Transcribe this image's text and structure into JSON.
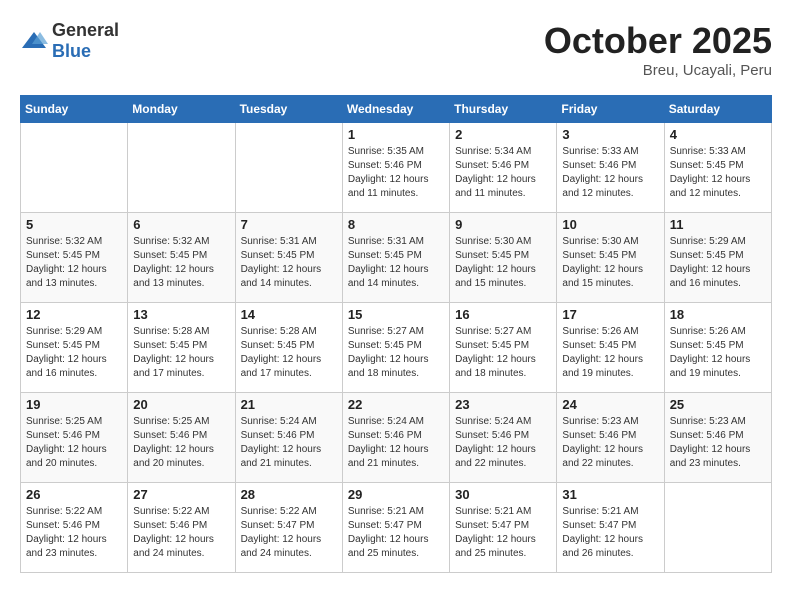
{
  "header": {
    "logo_general": "General",
    "logo_blue": "Blue",
    "title": "October 2025",
    "subtitle": "Breu, Ucayali, Peru"
  },
  "days_of_week": [
    "Sunday",
    "Monday",
    "Tuesday",
    "Wednesday",
    "Thursday",
    "Friday",
    "Saturday"
  ],
  "weeks": [
    [
      {
        "day": "",
        "info": ""
      },
      {
        "day": "",
        "info": ""
      },
      {
        "day": "",
        "info": ""
      },
      {
        "day": "1",
        "info": "Sunrise: 5:35 AM\nSunset: 5:46 PM\nDaylight: 12 hours and 11 minutes."
      },
      {
        "day": "2",
        "info": "Sunrise: 5:34 AM\nSunset: 5:46 PM\nDaylight: 12 hours and 11 minutes."
      },
      {
        "day": "3",
        "info": "Sunrise: 5:33 AM\nSunset: 5:46 PM\nDaylight: 12 hours and 12 minutes."
      },
      {
        "day": "4",
        "info": "Sunrise: 5:33 AM\nSunset: 5:45 PM\nDaylight: 12 hours and 12 minutes."
      }
    ],
    [
      {
        "day": "5",
        "info": "Sunrise: 5:32 AM\nSunset: 5:45 PM\nDaylight: 12 hours and 13 minutes."
      },
      {
        "day": "6",
        "info": "Sunrise: 5:32 AM\nSunset: 5:45 PM\nDaylight: 12 hours and 13 minutes."
      },
      {
        "day": "7",
        "info": "Sunrise: 5:31 AM\nSunset: 5:45 PM\nDaylight: 12 hours and 14 minutes."
      },
      {
        "day": "8",
        "info": "Sunrise: 5:31 AM\nSunset: 5:45 PM\nDaylight: 12 hours and 14 minutes."
      },
      {
        "day": "9",
        "info": "Sunrise: 5:30 AM\nSunset: 5:45 PM\nDaylight: 12 hours and 15 minutes."
      },
      {
        "day": "10",
        "info": "Sunrise: 5:30 AM\nSunset: 5:45 PM\nDaylight: 12 hours and 15 minutes."
      },
      {
        "day": "11",
        "info": "Sunrise: 5:29 AM\nSunset: 5:45 PM\nDaylight: 12 hours and 16 minutes."
      }
    ],
    [
      {
        "day": "12",
        "info": "Sunrise: 5:29 AM\nSunset: 5:45 PM\nDaylight: 12 hours and 16 minutes."
      },
      {
        "day": "13",
        "info": "Sunrise: 5:28 AM\nSunset: 5:45 PM\nDaylight: 12 hours and 17 minutes."
      },
      {
        "day": "14",
        "info": "Sunrise: 5:28 AM\nSunset: 5:45 PM\nDaylight: 12 hours and 17 minutes."
      },
      {
        "day": "15",
        "info": "Sunrise: 5:27 AM\nSunset: 5:45 PM\nDaylight: 12 hours and 18 minutes."
      },
      {
        "day": "16",
        "info": "Sunrise: 5:27 AM\nSunset: 5:45 PM\nDaylight: 12 hours and 18 minutes."
      },
      {
        "day": "17",
        "info": "Sunrise: 5:26 AM\nSunset: 5:45 PM\nDaylight: 12 hours and 19 minutes."
      },
      {
        "day": "18",
        "info": "Sunrise: 5:26 AM\nSunset: 5:45 PM\nDaylight: 12 hours and 19 minutes."
      }
    ],
    [
      {
        "day": "19",
        "info": "Sunrise: 5:25 AM\nSunset: 5:46 PM\nDaylight: 12 hours and 20 minutes."
      },
      {
        "day": "20",
        "info": "Sunrise: 5:25 AM\nSunset: 5:46 PM\nDaylight: 12 hours and 20 minutes."
      },
      {
        "day": "21",
        "info": "Sunrise: 5:24 AM\nSunset: 5:46 PM\nDaylight: 12 hours and 21 minutes."
      },
      {
        "day": "22",
        "info": "Sunrise: 5:24 AM\nSunset: 5:46 PM\nDaylight: 12 hours and 21 minutes."
      },
      {
        "day": "23",
        "info": "Sunrise: 5:24 AM\nSunset: 5:46 PM\nDaylight: 12 hours and 22 minutes."
      },
      {
        "day": "24",
        "info": "Sunrise: 5:23 AM\nSunset: 5:46 PM\nDaylight: 12 hours and 22 minutes."
      },
      {
        "day": "25",
        "info": "Sunrise: 5:23 AM\nSunset: 5:46 PM\nDaylight: 12 hours and 23 minutes."
      }
    ],
    [
      {
        "day": "26",
        "info": "Sunrise: 5:22 AM\nSunset: 5:46 PM\nDaylight: 12 hours and 23 minutes."
      },
      {
        "day": "27",
        "info": "Sunrise: 5:22 AM\nSunset: 5:46 PM\nDaylight: 12 hours and 24 minutes."
      },
      {
        "day": "28",
        "info": "Sunrise: 5:22 AM\nSunset: 5:47 PM\nDaylight: 12 hours and 24 minutes."
      },
      {
        "day": "29",
        "info": "Sunrise: 5:21 AM\nSunset: 5:47 PM\nDaylight: 12 hours and 25 minutes."
      },
      {
        "day": "30",
        "info": "Sunrise: 5:21 AM\nSunset: 5:47 PM\nDaylight: 12 hours and 25 minutes."
      },
      {
        "day": "31",
        "info": "Sunrise: 5:21 AM\nSunset: 5:47 PM\nDaylight: 12 hours and 26 minutes."
      },
      {
        "day": "",
        "info": ""
      }
    ]
  ]
}
